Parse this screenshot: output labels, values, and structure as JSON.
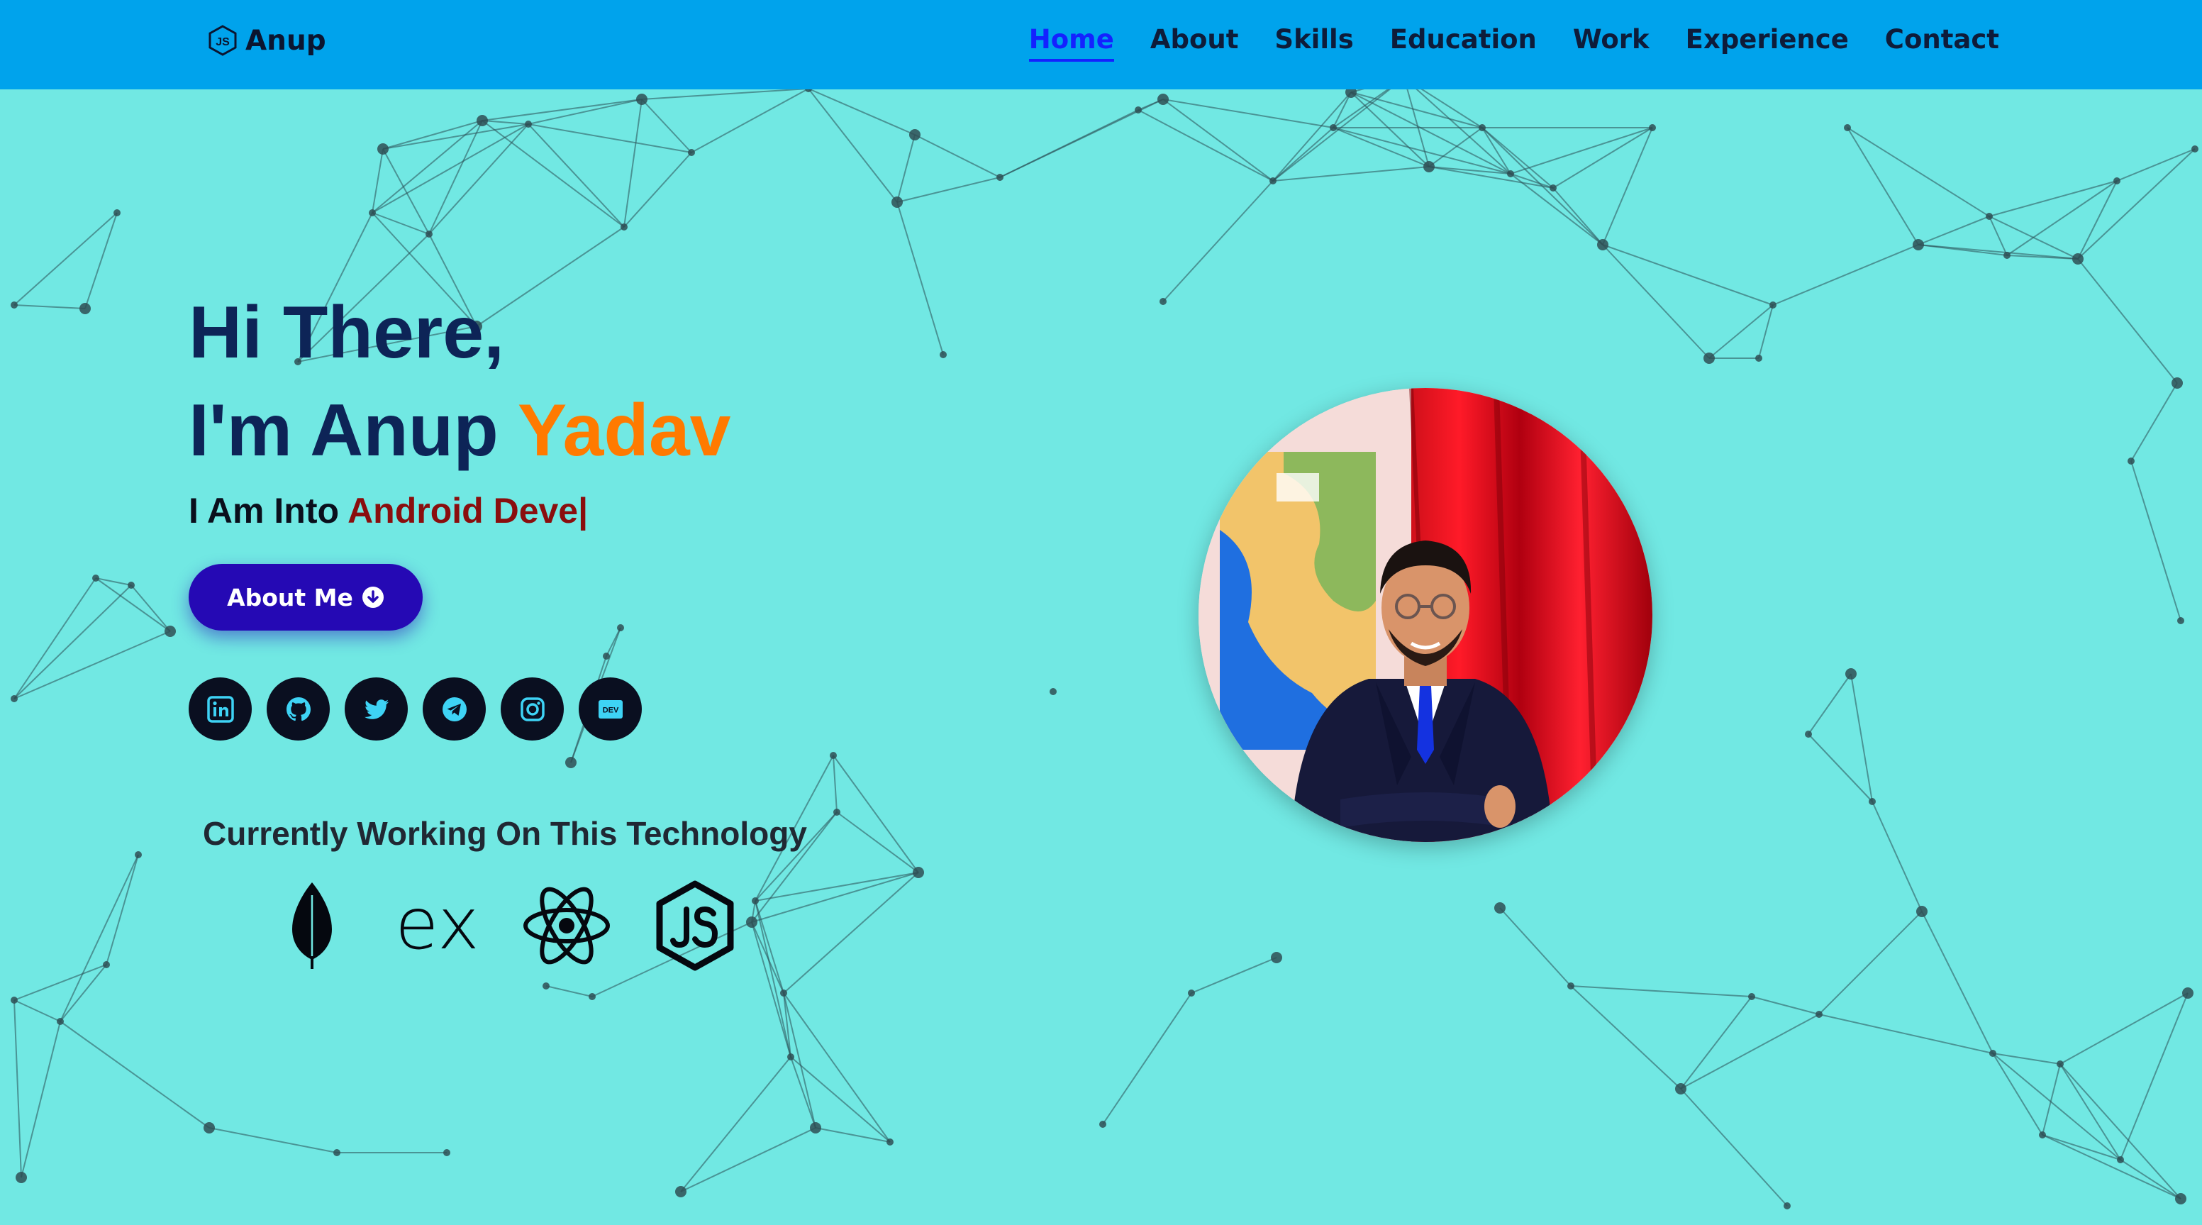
{
  "colors": {
    "background": "#71e8e3",
    "navbar": "#00a3ec",
    "nav_active": "#1422ff",
    "heading": "#0d2457",
    "accent_orange": "#ff7a00",
    "typed_text": "#8a0e0e",
    "button": "#2509b4",
    "social_bg": "#0a0f20",
    "social_icon": "#3ed3f5"
  },
  "navbar": {
    "brand_icon": "js-hexagon-icon",
    "brand_name": "Anup",
    "links": [
      {
        "label": "Home",
        "active": true
      },
      {
        "label": "About",
        "active": false
      },
      {
        "label": "Skills",
        "active": false
      },
      {
        "label": "Education",
        "active": false
      },
      {
        "label": "Work",
        "active": false
      },
      {
        "label": "Experience",
        "active": false
      },
      {
        "label": "Contact",
        "active": false
      }
    ]
  },
  "hero": {
    "greeting_line1": "Hi There,",
    "greeting_line2_prefix": "I'm Anup ",
    "greeting_line2_accent": "Yadav",
    "typing_prefix": "I Am Into ",
    "typing_value": "Android Deve|",
    "button_label": "About Me",
    "button_icon": "arrow-down-circle-icon",
    "socials": [
      {
        "name": "linkedin",
        "icon": "linkedin-icon"
      },
      {
        "name": "github",
        "icon": "github-icon"
      },
      {
        "name": "twitter",
        "icon": "twitter-icon"
      },
      {
        "name": "telegram",
        "icon": "telegram-icon"
      },
      {
        "name": "instagram",
        "icon": "instagram-icon"
      },
      {
        "name": "dev",
        "icon": "dev-icon"
      }
    ],
    "tech_heading": "Currently Working On This Technology",
    "tech_icons": [
      "mongodb-leaf-icon",
      "express-icon",
      "react-icon",
      "nodejs-icon"
    ],
    "express_glyph": "ex",
    "dev_glyph": "DEV"
  },
  "profile": {
    "photo": "profile-photo"
  }
}
